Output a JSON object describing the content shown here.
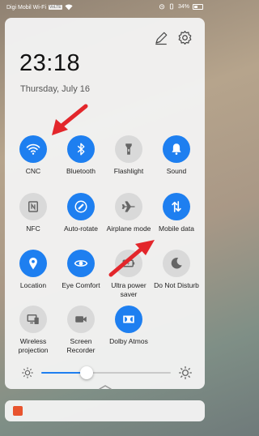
{
  "status": {
    "carrier": "Digi Mobil Wi-Fi",
    "volte": "VoLTE",
    "battery": "34%"
  },
  "clock": {
    "time": "23:18",
    "date": "Thursday, July 16"
  },
  "tiles": [
    {
      "label": "CNC",
      "icon": "wifi-icon",
      "active": true
    },
    {
      "label": "Bluetooth",
      "icon": "bluetooth-icon",
      "active": true
    },
    {
      "label": "Flashlight",
      "icon": "flashlight-icon",
      "active": false
    },
    {
      "label": "Sound",
      "icon": "bell-icon",
      "active": true
    },
    {
      "label": "NFC",
      "icon": "nfc-icon",
      "active": false
    },
    {
      "label": "Auto-rotate",
      "icon": "auto-rotate-icon",
      "active": true
    },
    {
      "label": "Airplane mode",
      "icon": "airplane-icon",
      "active": false
    },
    {
      "label": "Mobile data",
      "icon": "mobile-data-icon",
      "active": true
    },
    {
      "label": "Location",
      "icon": "location-icon",
      "active": true
    },
    {
      "label": "Eye Comfort",
      "icon": "eye-icon",
      "active": true
    },
    {
      "label": "Ultra power saver",
      "icon": "power-saver-icon",
      "active": false
    },
    {
      "label": "Do Not Disturb",
      "icon": "moon-icon",
      "active": false
    },
    {
      "label": "Wireless projection",
      "icon": "projection-icon",
      "active": false
    },
    {
      "label": "Screen Recorder",
      "icon": "screen-recorder-icon",
      "active": false
    },
    {
      "label": "Dolby Atmos",
      "icon": "dolby-icon",
      "active": true
    }
  ],
  "brightness": {
    "level": 0.35
  },
  "colors": {
    "accent": "#1e7ff0",
    "annotation_arrow": "#e3262b"
  }
}
